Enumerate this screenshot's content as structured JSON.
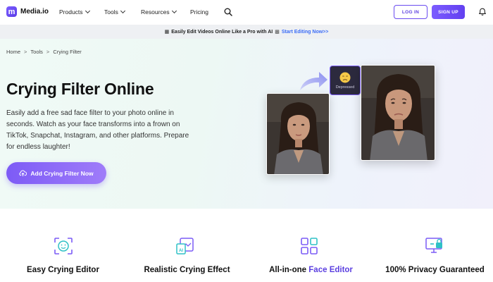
{
  "nav": {
    "logo_text": "Media.io",
    "logo_mark": "m",
    "menu": [
      "Products",
      "Tools",
      "Resources",
      "Pricing"
    ],
    "login": "LOG IN",
    "signup": "SIGN UP"
  },
  "promo": {
    "text": "Easily Edit Videos Online Like a Pro with AI",
    "link": "Start Editing Now>>"
  },
  "breadcrumb": [
    "Home",
    "Tools",
    "Crying Filter"
  ],
  "hero": {
    "title": "Crying Filter Online",
    "description": "Easily add a free sad face filter to your photo online in seconds. Watch as your face transforms into a frown on TikTok, Snapchat, Instagram, and other platforms. Prepare for endless laughter!",
    "cta": "Add Crying Filter Now",
    "emoji_label": "Depressed"
  },
  "features": [
    {
      "title": "Easy Crying Editor",
      "icon": "face-scan-icon"
    },
    {
      "title": "Realistic Crying Effect",
      "icon": "ai-image-icon"
    },
    {
      "title_plain": "All-in-one ",
      "title_highlight": "Face Editor",
      "icon": "grid-icon"
    },
    {
      "title": "100% Privacy Guaranteed",
      "icon": "privacy-screen-icon"
    }
  ],
  "colors": {
    "accent": "#6a4cf0",
    "link": "#3b6cf6"
  }
}
